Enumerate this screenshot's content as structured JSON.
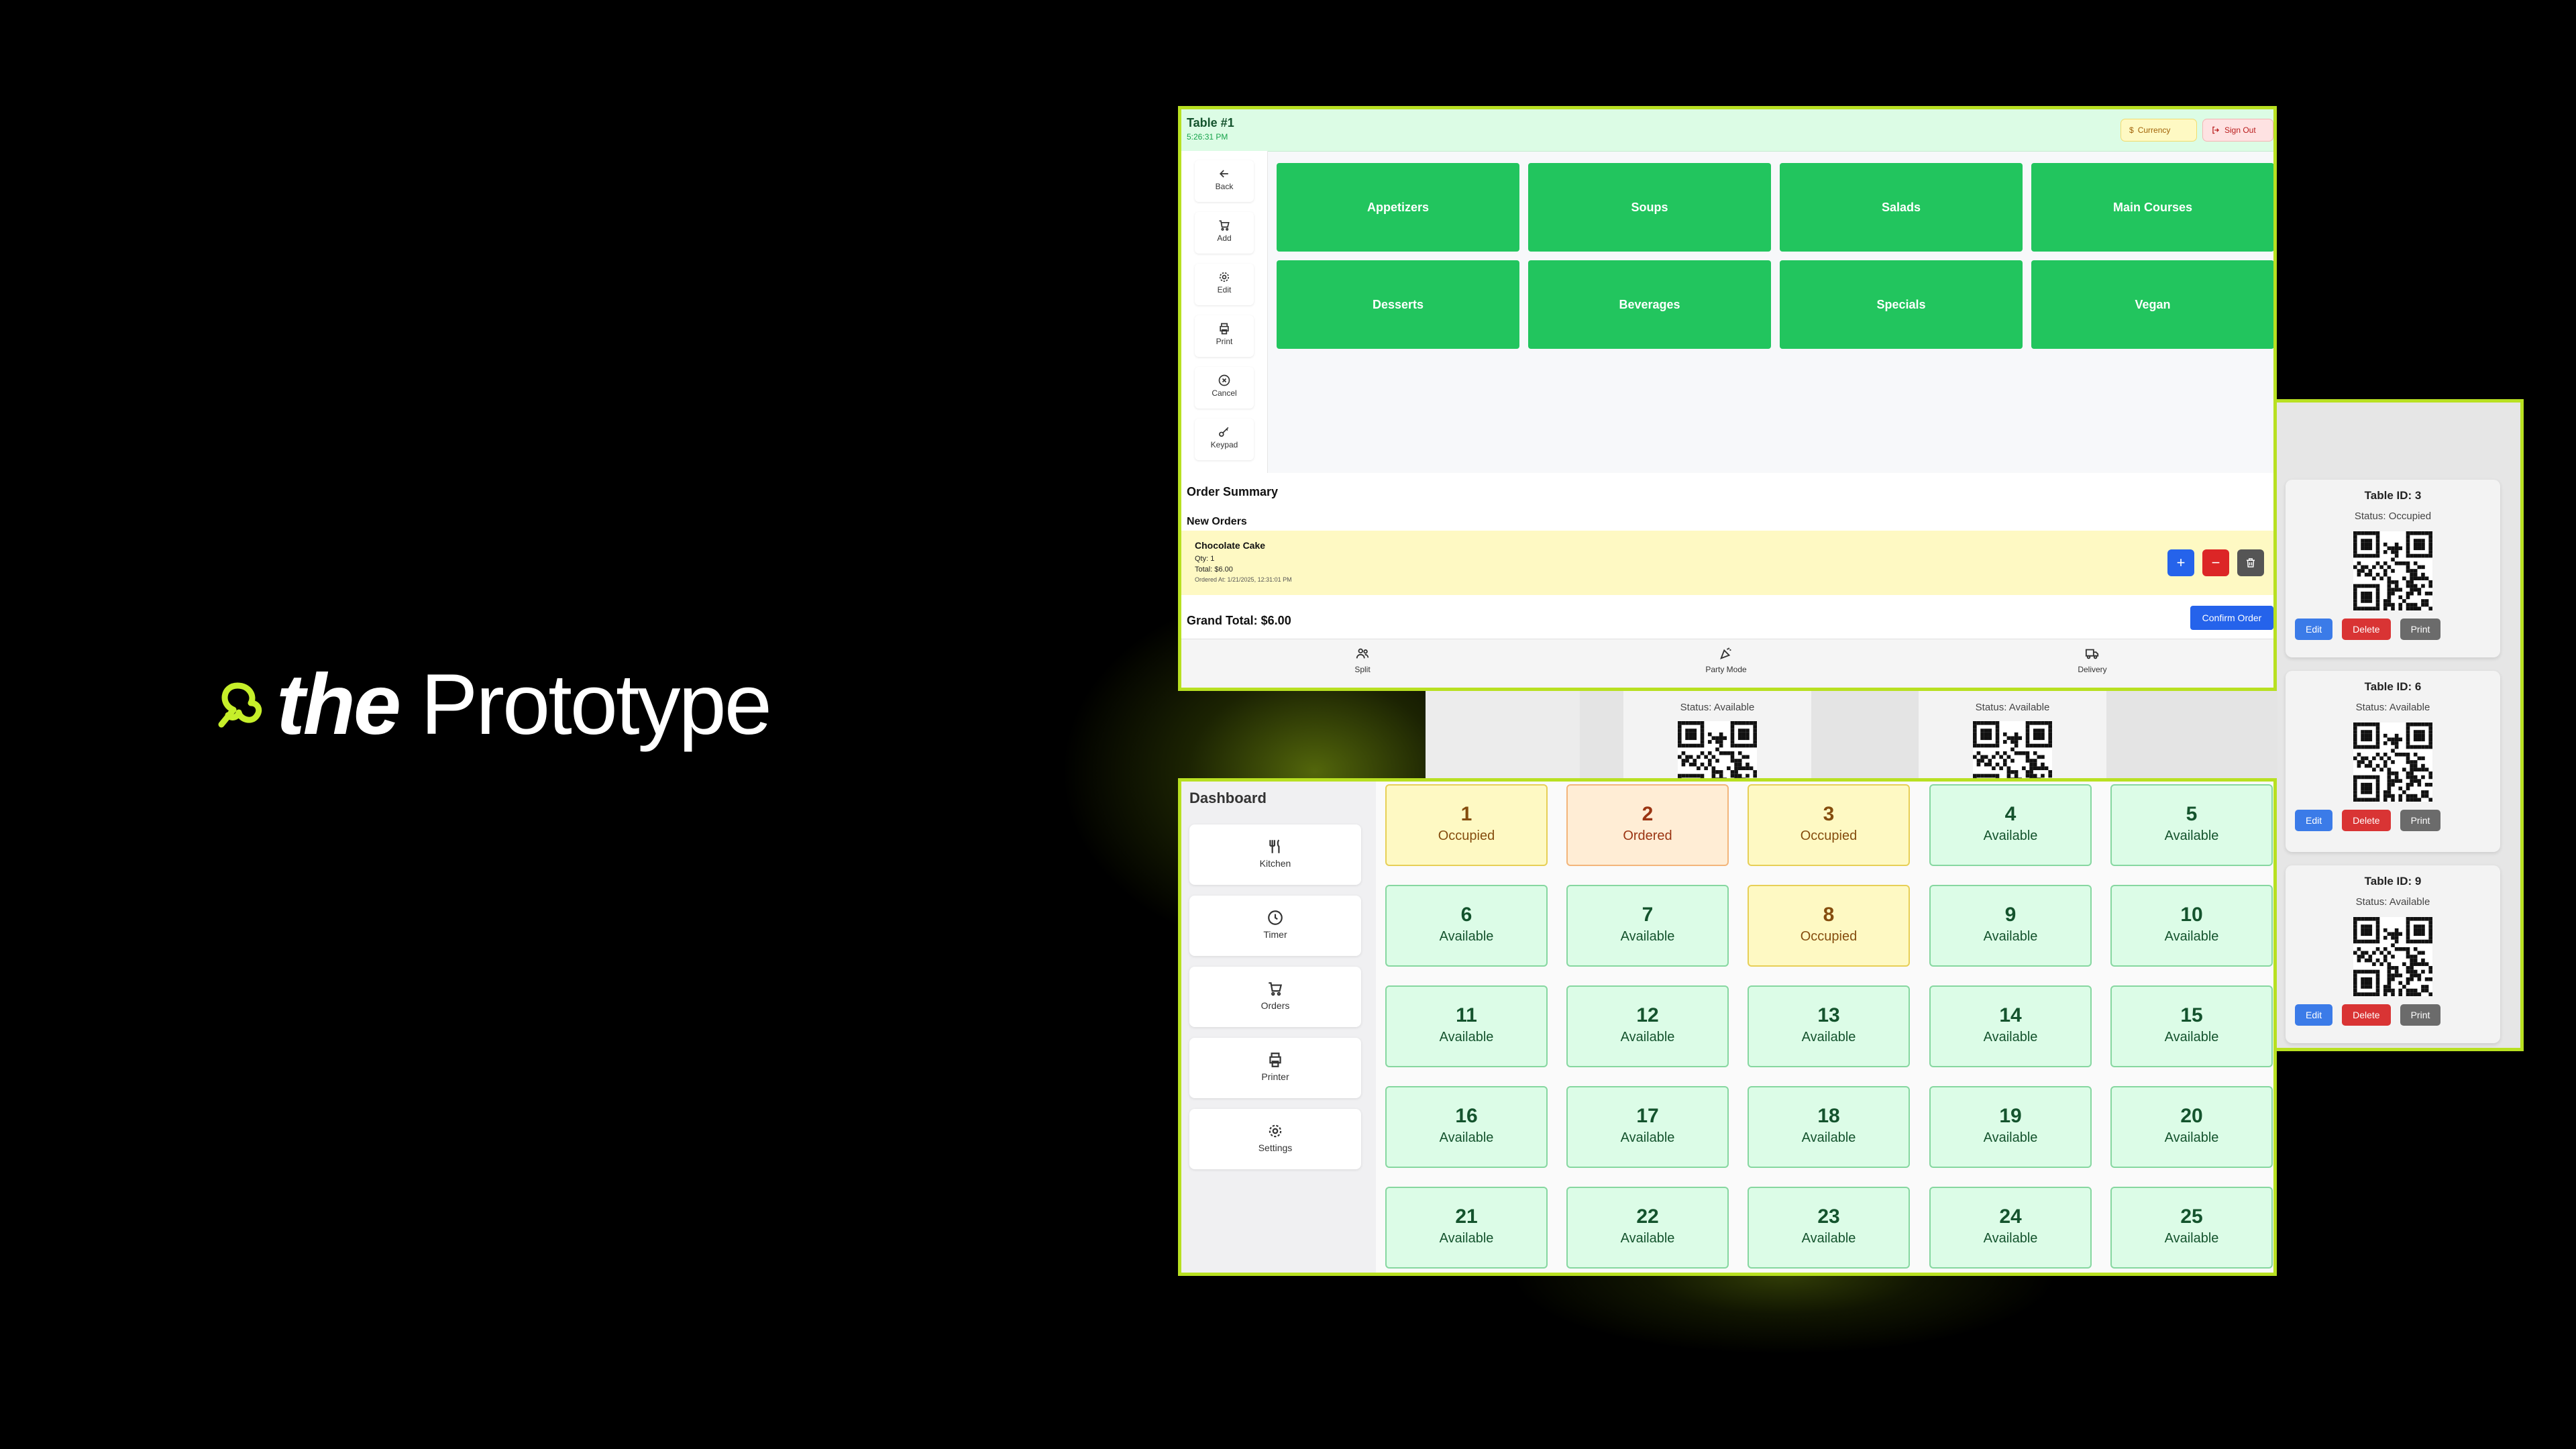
{
  "brand": {
    "the": "the",
    "name": "Prototype"
  },
  "qr_panel": {
    "cards": [
      {
        "id_label": "Table ID: 3",
        "status": "Status: Occupied"
      },
      {
        "id_label": "Table ID: 6",
        "status": "Status: Available"
      },
      {
        "id_label": "Table ID: 9",
        "status": "Status: Available"
      }
    ],
    "edit_label": "Edit",
    "delete_label": "Delete",
    "print_label": "Print",
    "mid_status_1": "Status: Available",
    "mid_status_2": "Status: Available"
  },
  "order": {
    "title": "Table #1",
    "time": "5:26:31 PM",
    "currency_label": "Currency",
    "signout_label": "Sign Out",
    "sidebar": [
      {
        "label": "Back",
        "icon": "arrow-left-icon"
      },
      {
        "label": "Add",
        "icon": "cart-icon"
      },
      {
        "label": "Edit",
        "icon": "gear-icon"
      },
      {
        "label": "Print",
        "icon": "printer-icon"
      },
      {
        "label": "Cancel",
        "icon": "circle-x-icon"
      },
      {
        "label": "Keypad",
        "icon": "key-icon"
      }
    ],
    "categories": [
      "Appetizers",
      "Soups",
      "Salads",
      "Main Courses",
      "Desserts",
      "Beverages",
      "Specials",
      "Vegan"
    ],
    "summary_title": "Order Summary",
    "new_orders_label": "New Orders",
    "item": {
      "name": "Chocolate Cake",
      "qty": "Qty: 1",
      "total": "Total: $6.00",
      "ordered_at": "Ordered At: 1/21/2025, 12:31:01 PM"
    },
    "grand_total": "Grand Total: $6.00",
    "confirm_label": "Confirm Order",
    "footer": [
      {
        "label": "Split",
        "icon": "users-icon"
      },
      {
        "label": "Party Mode",
        "icon": "party-icon"
      },
      {
        "label": "Delivery",
        "icon": "truck-icon"
      }
    ]
  },
  "dashboard": {
    "title": "Dashboard",
    "sidebar": [
      {
        "label": "Kitchen",
        "icon": "utensils-icon"
      },
      {
        "label": "Timer",
        "icon": "clock-icon"
      },
      {
        "label": "Orders",
        "icon": "cart-icon"
      },
      {
        "label": "Printer",
        "icon": "printer-icon"
      },
      {
        "label": "Settings",
        "icon": "gear-icon"
      }
    ],
    "tables": [
      {
        "num": "1",
        "status": "Occupied"
      },
      {
        "num": "2",
        "status": "Ordered"
      },
      {
        "num": "3",
        "status": "Occupied"
      },
      {
        "num": "4",
        "status": "Available"
      },
      {
        "num": "5",
        "status": "Available"
      },
      {
        "num": "6",
        "status": "Available"
      },
      {
        "num": "7",
        "status": "Available"
      },
      {
        "num": "8",
        "status": "Occupied"
      },
      {
        "num": "9",
        "status": "Available"
      },
      {
        "num": "10",
        "status": "Available"
      },
      {
        "num": "11",
        "status": "Available"
      },
      {
        "num": "12",
        "status": "Available"
      },
      {
        "num": "13",
        "status": "Available"
      },
      {
        "num": "14",
        "status": "Available"
      },
      {
        "num": "15",
        "status": "Available"
      },
      {
        "num": "16",
        "status": "Available"
      },
      {
        "num": "17",
        "status": "Available"
      },
      {
        "num": "18",
        "status": "Available"
      },
      {
        "num": "19",
        "status": "Available"
      },
      {
        "num": "20",
        "status": "Available"
      },
      {
        "num": "21",
        "status": "Available"
      },
      {
        "num": "22",
        "status": "Available"
      },
      {
        "num": "23",
        "status": "Available"
      },
      {
        "num": "24",
        "status": "Available"
      },
      {
        "num": "25",
        "status": "Available"
      }
    ]
  },
  "colors": {
    "background": "#000000",
    "accent_lime": "#b8e021",
    "category_green": "#22c55e",
    "available": "#dcfce7",
    "occupied": "#fef9c3",
    "ordered": "#ffedd5",
    "primary_blue": "#2563eb",
    "danger_red": "#dc2626"
  }
}
